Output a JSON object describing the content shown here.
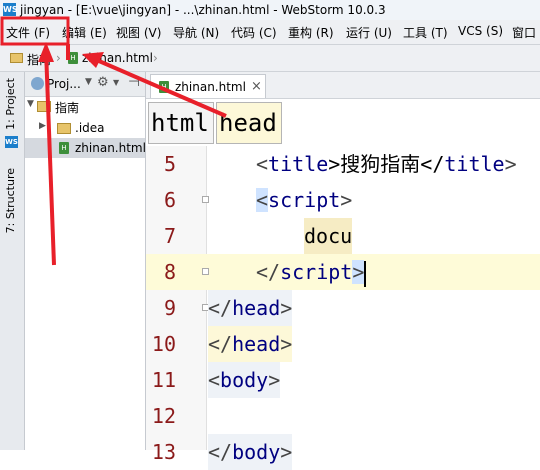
{
  "window": {
    "title": "jingyan - [E:\\vue\\jingyan] - ...\\zhinan.html - WebStorm 10.0.3",
    "app_icon": "WS"
  },
  "menu": [
    "文件 (F)",
    "编辑 (E)",
    "视图 (V)",
    "导航 (N)",
    "代码 (C)",
    "重构 (R)",
    "运行 (U)",
    "工具 (T)",
    "VCS (S)",
    "窗口"
  ],
  "navbar": {
    "crumbs": [
      "指南",
      "zhinan.html"
    ]
  },
  "sidebar": {
    "project_tab": "1: Project",
    "structure_tab": "7: Structure"
  },
  "project": {
    "header": "Proj...",
    "items": [
      {
        "label": "指南"
      },
      {
        "label": ".idea"
      },
      {
        "label": "zhinan.html"
      }
    ]
  },
  "editor": {
    "tab": {
      "label": "zhinan.html",
      "close": "×"
    },
    "breadcrumbs": [
      "html",
      "head"
    ],
    "lines": [
      {
        "num": "5",
        "parts": [
          "<",
          "title",
          ">搜狗指南</",
          "title",
          ">"
        ]
      },
      {
        "num": "6",
        "open": "<",
        "tag": "script",
        "close": ">"
      },
      {
        "num": "7",
        "word": "docu"
      },
      {
        "num": "8",
        "open": "</",
        "tag": "script",
        "close": ">"
      },
      {
        "num": "9",
        "open": "</",
        "tag": "head",
        "close": ">"
      },
      {
        "num": "10",
        "open": "</",
        "tag": "head",
        "close": ">"
      },
      {
        "num": "11",
        "open": "<",
        "tag": "body",
        "close": ">"
      },
      {
        "num": "12"
      },
      {
        "num": "13",
        "open": "</",
        "tag": "body",
        "close": ">"
      }
    ]
  },
  "colors": {
    "annotation": "#e8202a",
    "current_line": "#fefbd8",
    "line_number": "#8b1a1a",
    "tag": "#000080"
  }
}
